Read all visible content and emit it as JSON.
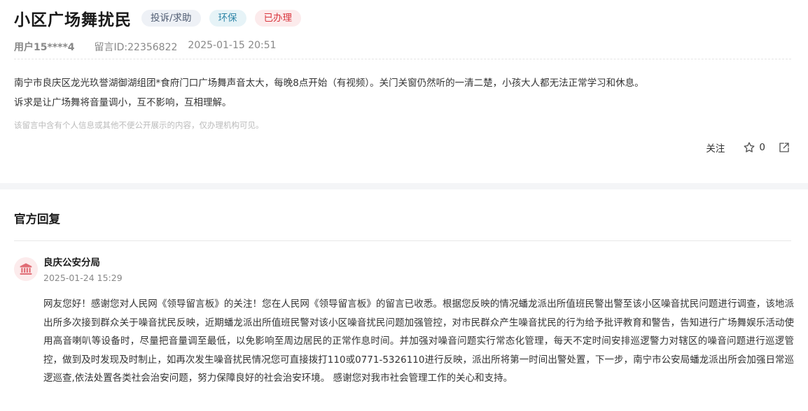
{
  "message": {
    "title": "小区广场舞扰民",
    "tags": [
      "投诉/求助",
      "环保",
      "已办理"
    ],
    "tag_colors": {
      "category": "#4d5a70",
      "environment": "#2f86a8",
      "status": "#d9363e"
    },
    "user": "用户15****4",
    "message_id": "留言ID:22356822",
    "datetime": "2025-01-15 20:51",
    "content_lines": [
      "南宁市良庆区龙光玖誉湖御湖组团*食府门口广场舞声音太大，每晚8点开始（有视频）。关门关窗仍然听的一清二楚，小孩大人都无法正常学习和休息。",
      "诉求是让广场舞将音量调小，互不影响，互相理解。"
    ],
    "privacy_note": "该留言中含有个人信息或其他不便公开展示的内容，仅办理机构可见。",
    "actions": {
      "follow_label": "关注",
      "like_count": "0",
      "star_icon": "star-outline-icon",
      "share_icon": "share-icon"
    }
  },
  "reply": {
    "section_title": "官方回复",
    "org_name": "良庆公安分局",
    "org_icon": "government-building-icon",
    "datetime": "2025-01-24 15:29",
    "text": "网友您好！感谢您对人民网《领导留言板》的关注！您在人民网《领导留言板》的留言已收悉。根据您反映的情况蟠龙派出所值班民警出警至该小区噪音扰民问题进行调查，该地派出所多次接到群众关于噪音扰民反映，近期蟠龙派出所值班民警对该小区噪音扰民问题加强管控，对市民群众产生噪音扰民的行为给予批评教育和警告，告知进行广场舞娱乐活动使用高音喇叭等设备时，尽量把音量调至最低，以免影响至周边居民的正常作息时间。并加强对噪音问题实行常态化管理，每天不定时间安排巡逻警力对辖区的噪音问题进行巡逻管控，做到及时发现及时制止，如再次发生噪音扰民情况您可直接拨打110或0771-5326110进行反映，派出所将第一时间出警处置，下一步，南宁市公安局蟠龙派出所会加强日常巡逻巡查,依法处置各类社会治安问题，努力保障良好的社会治安环境。 感谢您对我市社会管理工作的关心和支持。"
  }
}
